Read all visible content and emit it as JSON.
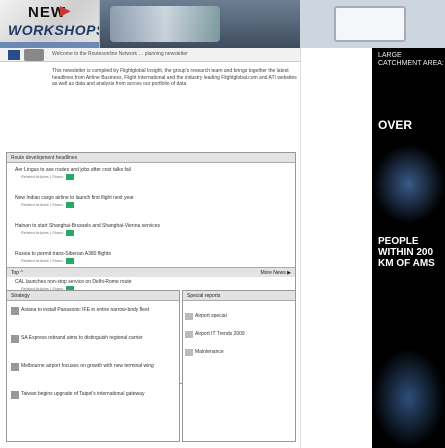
{
  "header": {
    "brand_line1": "NEW",
    "brand_line2": "WORKSHOPS",
    "brand_arrow": "▶"
  },
  "welcome": {
    "text": "Welcome to the Routesonline Network … planning newsletter"
  },
  "intro": {
    "text": "This newsletter is compiled by Flightglobal Insight, the group's research team and brings together the latest headlines from Airline Business, Flight International and the industry leading Flightglobal.com and ATI websites as well as data and analysis from across our portfolio of data"
  },
  "route_box": {
    "heading": "Route development headlines",
    "items": [
      {
        "title": "Aer Lingus to axe routes and jobs after cost talks fail",
        "meta": "Related Articles | Share:"
      },
      {
        "title": "New Indian cargo airline to launch first flight next year",
        "meta": "Related Articles | Share:"
      },
      {
        "title": "Hainan to start Shanghai-Brussels and Shanghai-Vienna services",
        "meta": "Related Articles | Share:"
      },
      {
        "title": "Russia to permit trans-Siberian A380 flights",
        "meta": "Related Articles | Share:"
      },
      {
        "title": "CAL launches non-stop service on Delhi-Rome route",
        "meta": "Related Articles | Share:"
      }
    ],
    "footer_left": "Top ^",
    "footer_right": "More News ▶"
  },
  "strategy": {
    "heading": "Strategy",
    "items": [
      "Asiana to install Panasonic IFE in entire narrow-body fleet",
      "SA Express rebrand aims to distinguish regional carrier",
      "Melbourne airport focuses on growth with new terminal wing",
      "Taiwan begins upgrade of Taipei's international gateway"
    ]
  },
  "special": {
    "heading": "Special reports",
    "items": [
      "Airport special",
      "Airport IT Trends 2009",
      "Maintenance"
    ]
  },
  "right_ad": {
    "large_text": "LARGE CATCHMENT AREA:",
    "over_text": "OVER",
    "people_text": "PEOPLE WITHIN 200 KM OF AMS"
  }
}
